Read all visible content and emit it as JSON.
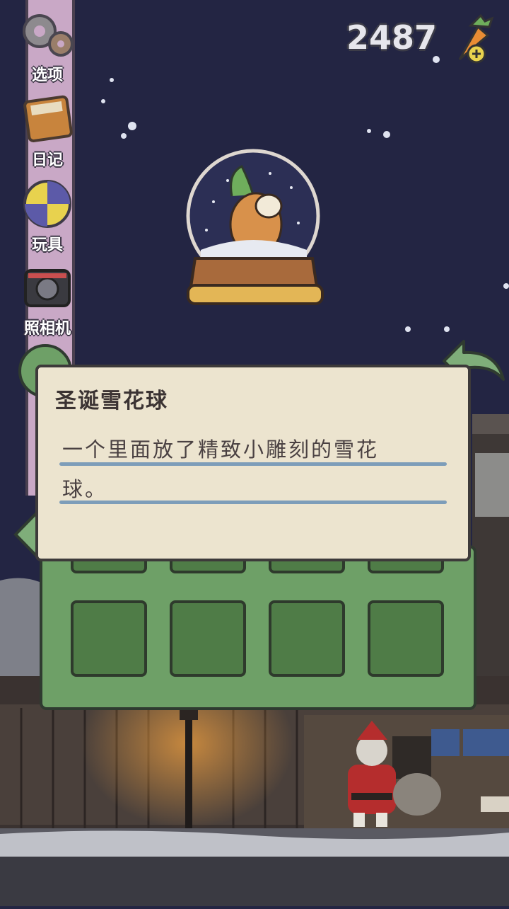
{
  "hud": {
    "carrot_count": "2487",
    "icons": {
      "currency": "carrot-icon",
      "add": "plus-icon"
    }
  },
  "sidebar": {
    "items": [
      {
        "label": "选项",
        "icon": "gear-icon"
      },
      {
        "label": "日记",
        "icon": "diary-icon"
      },
      {
        "label": "玩具",
        "icon": "toy-ball-icon"
      },
      {
        "label": "照相机",
        "icon": "camera-icon"
      }
    ]
  },
  "item_detail": {
    "title": "圣诞雪花球",
    "description_line1": "一个里面放了精致小雕刻的雪花",
    "description_line2": "球。",
    "image": "snow-globe-icon"
  },
  "colors": {
    "night_sky": "#232543",
    "sidebar": "#c9a8c6",
    "panel_green": "#6ea067",
    "card_bg": "#ece4cf",
    "rule_blue": "#7d9db9"
  }
}
